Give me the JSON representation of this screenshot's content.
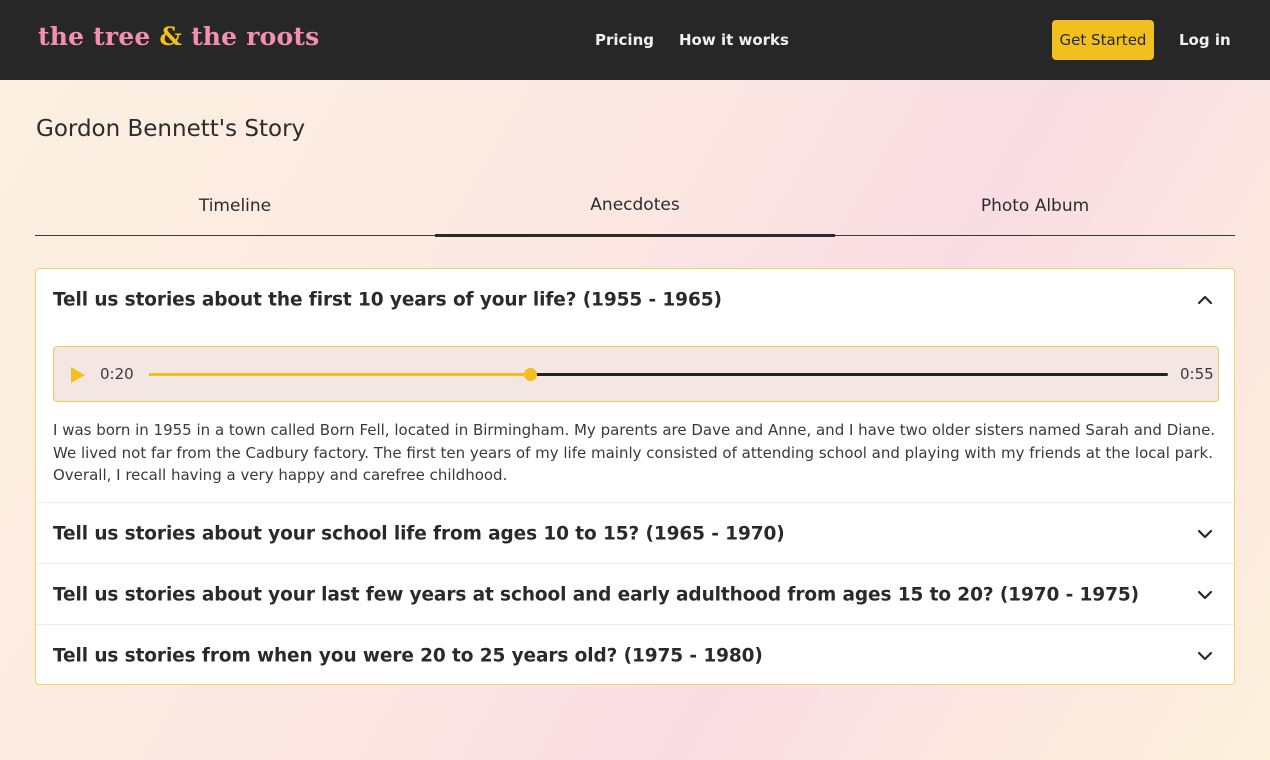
{
  "header": {
    "logo_part1": "the tree",
    "logo_amp": "&",
    "logo_part2": "the roots",
    "nav": {
      "pricing": "Pricing",
      "how_it_works": "How it works",
      "get_started": "Get Started",
      "login": "Log in"
    }
  },
  "page": {
    "title": "Gordon Bennett's Story"
  },
  "tabs": [
    {
      "label": "Timeline",
      "active": false
    },
    {
      "label": "Anecdotes",
      "active": true
    },
    {
      "label": "Photo Album",
      "active": false
    }
  ],
  "anecdotes": [
    {
      "question": "Tell us stories about the first 10 years of your life? (1955 - 1965)",
      "expanded": true,
      "audio": {
        "current_time": "0:20",
        "duration": "0:55",
        "progress": 0.3735
      },
      "answer": "I was born in 1955 in a town called Born Fell, located in Birmingham. My parents are Dave and Anne, and I have two older sisters named Sarah and Diane. We lived not far from the Cadbury factory. The first ten years of my life mainly consisted of attending school and playing with my friends at the local park. Overall, I recall having a very happy and carefree childhood."
    },
    {
      "question": "Tell us stories about your school life from ages 10 to 15? (1965 - 1970)",
      "expanded": false
    },
    {
      "question": "Tell us stories about your last few years at school and early adulthood from ages 15 to 20? (1970 - 1975)",
      "expanded": false
    },
    {
      "question": "Tell us stories from when you were 20 to 25 years old? (1975 - 1980)",
      "expanded": false
    }
  ],
  "colors": {
    "accent": "#f2c01e",
    "logo_pink": "#f48fb1",
    "nav_bg": "#272727"
  },
  "icons": {
    "expanded": "chevron-up-icon",
    "collapsed": "chevron-down-icon",
    "play": "play-icon"
  }
}
